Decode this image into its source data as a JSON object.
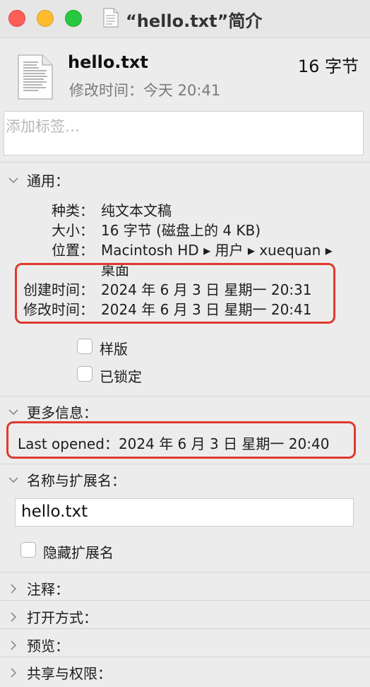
{
  "window": {
    "title": "“hello.txt”简介"
  },
  "header": {
    "file_name": "hello.txt",
    "file_size": "16 字节",
    "modified": "修改时间：今天 20:41"
  },
  "tags": {
    "placeholder": "添加标签…"
  },
  "general": {
    "title": "通用：",
    "kind_label": "种类：",
    "kind_value": "纯文本文稿",
    "size_label": "大小：",
    "size_value": "16 字节 (磁盘上的 4 KB)",
    "where_label": "位置：",
    "where_value_line1": "Macintosh HD ▸ 用户 ▸ xuequan ▸",
    "where_value_line2": "桌面",
    "created_label": "创建时间：",
    "created_value": "2024 年 6 月 3 日 星期一 20:31",
    "modified_label": "修改时间：",
    "modified_value": "2024 年 6 月 3 日 星期一 20:41",
    "stationery_label": "样版",
    "locked_label": "已锁定"
  },
  "more_info": {
    "title": "更多信息：",
    "last_opened_label": "Last opened：",
    "last_opened_value": "2024 年 6 月 3 日 星期一 20:40"
  },
  "name_ext": {
    "title": "名称与扩展名：",
    "name_value": "hello.txt",
    "hide_ext_label": "隐藏扩展名"
  },
  "collapsed_sections": {
    "comments": "注释：",
    "open_with": "打开方式：",
    "preview": "预览：",
    "sharing": "共享与权限："
  },
  "colors": {
    "highlight": "#e03a2f",
    "background": "#ececec"
  }
}
